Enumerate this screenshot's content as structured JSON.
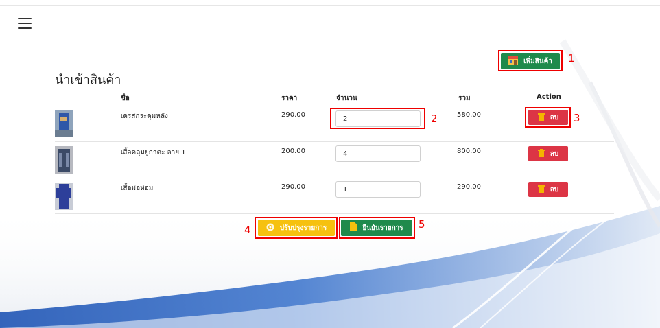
{
  "page": {
    "title": "นำเข้าสินค้า"
  },
  "add_button": {
    "label": "เพิ่มสินค้า"
  },
  "table": {
    "headers": [
      "ชื่อ",
      "ราคา",
      "จำนวน",
      "รวม",
      "Action"
    ],
    "rows": [
      {
        "name": "เดรสกระดุมหลัง",
        "price": "290.00",
        "qty": "2",
        "total": "580.00",
        "delete_label": "ลบ"
      },
      {
        "name": "เสื้อคลุมยูกาตะ ลาย 1",
        "price": "200.00",
        "qty": "4",
        "total": "800.00",
        "delete_label": "ลบ"
      },
      {
        "name": "เสื้อม่อห่อม",
        "price": "290.00",
        "qty": "1",
        "total": "290.00",
        "delete_label": "ลบ"
      }
    ]
  },
  "footer_buttons": {
    "update_label": "ปรับปรุงรายการ",
    "confirm_label": "ยืนยันรายการ"
  },
  "annotations": [
    "1",
    "2",
    "3",
    "4",
    "5"
  ],
  "colors": {
    "green": "#1f8a4c",
    "red": "#dc3545",
    "yellow": "#f6c10f",
    "highlight": "#ee0000"
  }
}
